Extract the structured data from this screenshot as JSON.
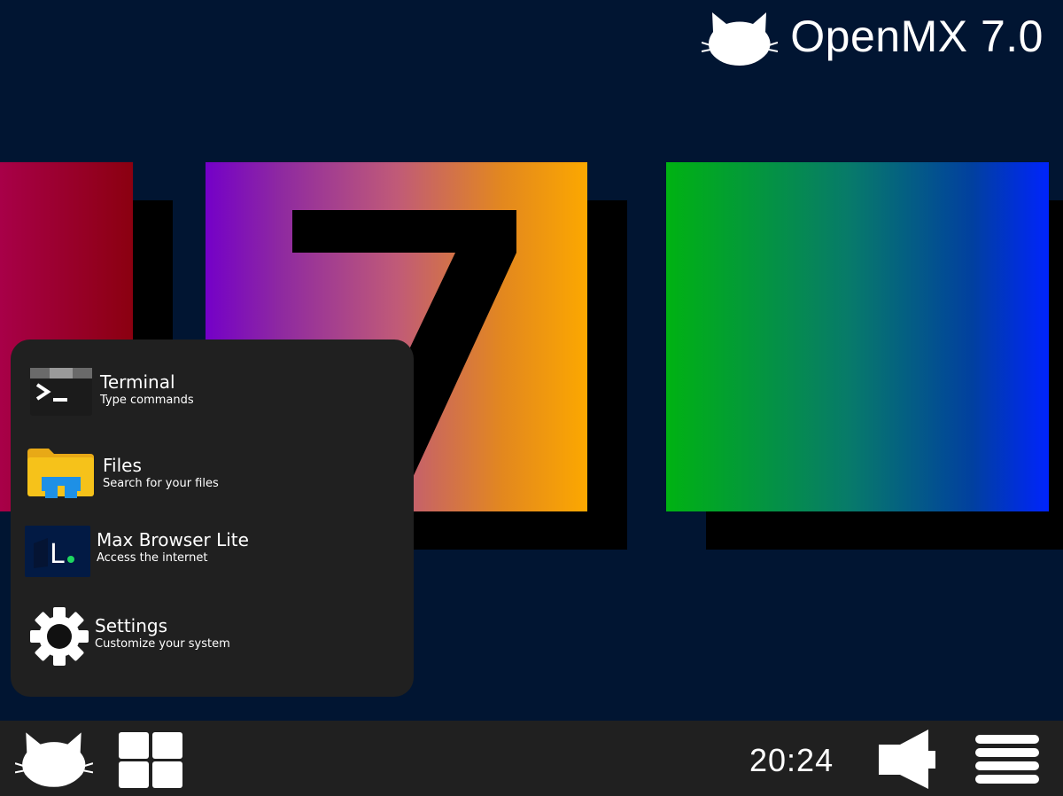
{
  "brand": {
    "name": "OpenMX 7.0",
    "logo_icon": "cat-icon"
  },
  "wallpaper": {
    "glyph": "7",
    "colors": {
      "background": "#011532",
      "red_block": [
        "#a80048",
        "#8b0010"
      ],
      "middle_block": [
        "#7400c8",
        "#fca800"
      ],
      "right_block": [
        "#00b212",
        "#0024fd"
      ],
      "shadow": "#000000"
    }
  },
  "start_menu": {
    "items": [
      {
        "title": "Terminal",
        "subtitle": "Type commands",
        "icon": "terminal-icon"
      },
      {
        "title": "Files",
        "subtitle": "Search for your files",
        "icon": "folder-icon"
      },
      {
        "title": "Max Browser Lite",
        "subtitle": "Access the internet",
        "icon": "browser-icon",
        "icon_letter": "L"
      },
      {
        "title": "Settings",
        "subtitle": "Customize your system",
        "icon": "gear-icon"
      }
    ]
  },
  "taskbar": {
    "start_icon": "cat-icon",
    "apps_icon": "grid-icon",
    "clock": "20:24",
    "volume_icon": "speaker-icon",
    "menu_icon": "hamburger-icon"
  },
  "colors": {
    "menu_background": "#202020",
    "taskbar_background": "#202020",
    "text": "#ffffff",
    "accent_green": "#1ed760",
    "folder_yellow": "#f6c21a",
    "folder_blue": "#1e90e6"
  }
}
